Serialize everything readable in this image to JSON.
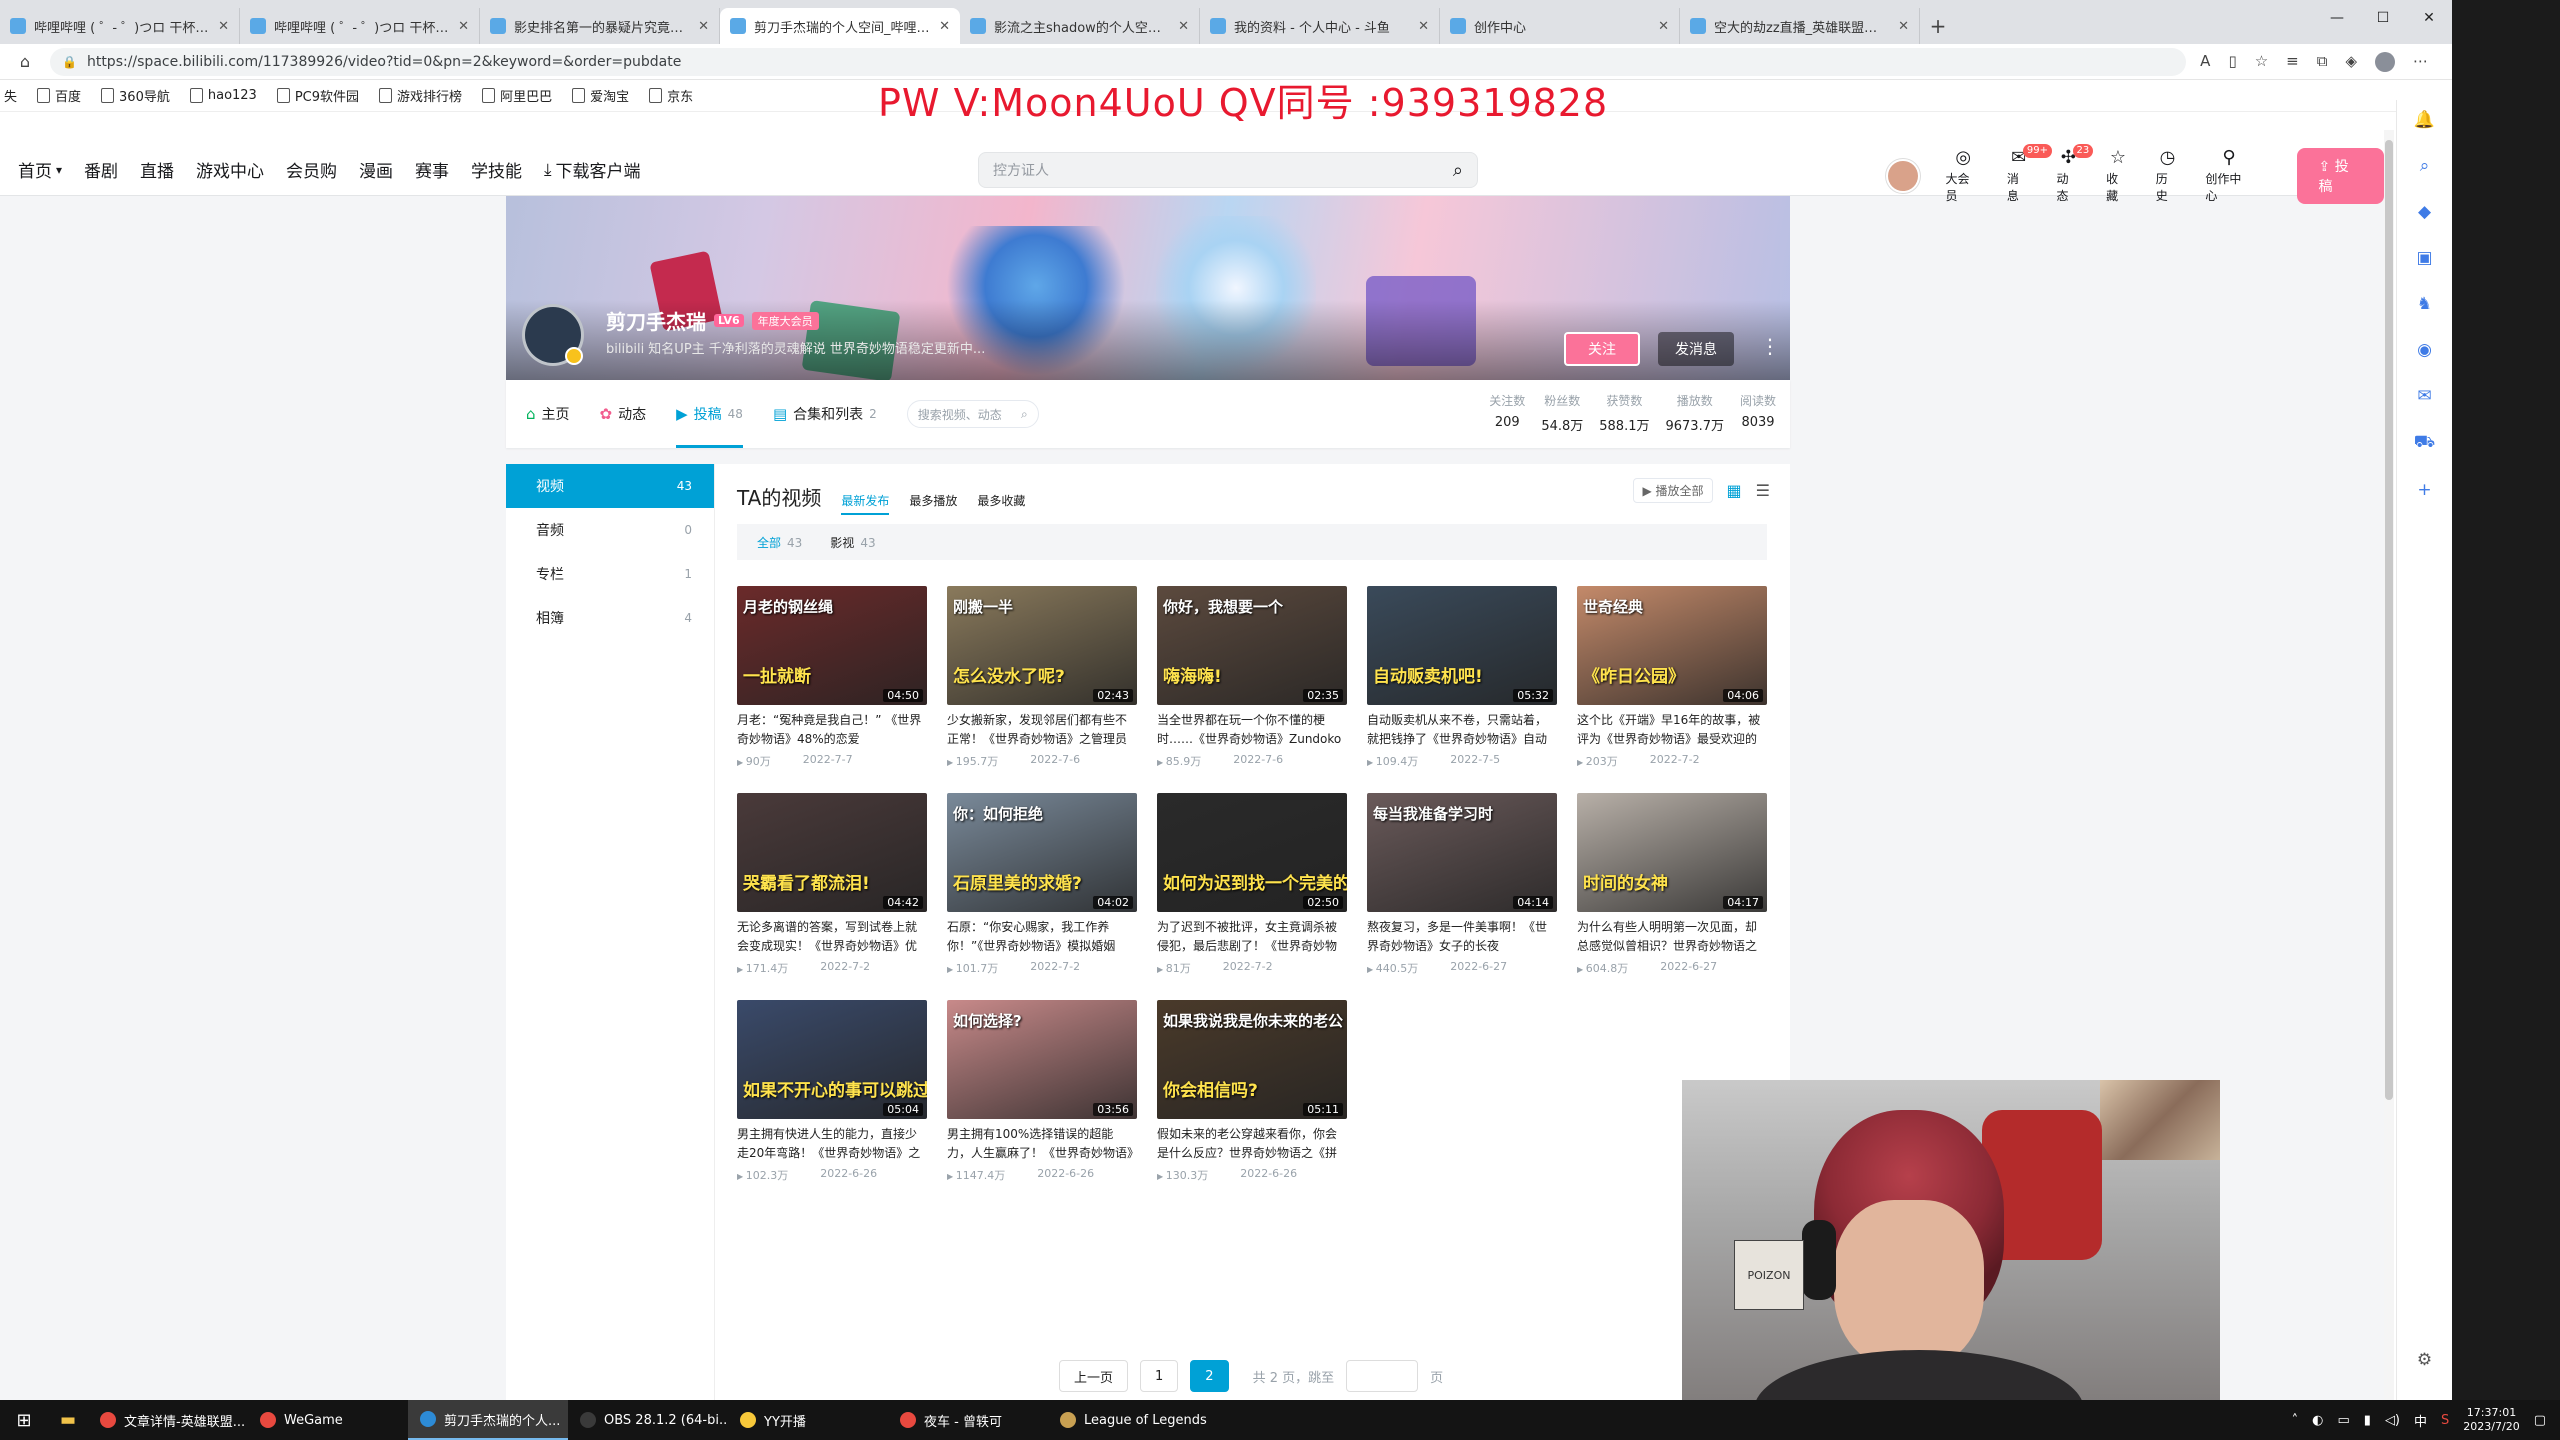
{
  "browser": {
    "tabs": [
      {
        "title": "哔哩哔哩 ( ゜- ゜)つロ 干杯~-bili",
        "active": false
      },
      {
        "title": "哔哩哔哩 ( ゜- ゜)つロ 干杯~-bili",
        "active": false
      },
      {
        "title": "影史排名第一的暴疑片究竟有多",
        "active": false
      },
      {
        "title": "剪刀手杰瑞的个人空间_哔哩哔哩",
        "active": true
      },
      {
        "title": "影流之主shadow的个人空间_哔",
        "active": false
      },
      {
        "title": "我的资料 - 个人中心 - 斗鱼",
        "active": false
      },
      {
        "title": "创作中心",
        "active": false
      },
      {
        "title": "空大的劫zz直播_英雄联盟直播_",
        "active": false
      }
    ],
    "url": "https://space.bilibili.com/117389926/video?tid=0&pn=2&keyword=&order=pubdate",
    "bookmarks": [
      "百度",
      "360导航",
      "hao123",
      "PC9软件园",
      "游戏排行榜",
      "阿里巴巴",
      "爱淘宝",
      "京东"
    ]
  },
  "watermark": "PW V:Moon4UoU QV同号 :939319828",
  "header": {
    "nav": [
      "首页",
      "番剧",
      "直播",
      "游戏中心",
      "会员购",
      "漫画",
      "赛事",
      "学技能",
      "下载客户端"
    ],
    "search_placeholder": "控方证人",
    "right": [
      {
        "label": "大会员",
        "icon": "vip-icon",
        "badge": ""
      },
      {
        "label": "消息",
        "icon": "message-icon",
        "badge": "99+"
      },
      {
        "label": "动态",
        "icon": "dynamic-icon",
        "badge": "23"
      },
      {
        "label": "收藏",
        "icon": "star-icon",
        "badge": ""
      },
      {
        "label": "历史",
        "icon": "history-icon",
        "badge": ""
      },
      {
        "label": "创作中心",
        "icon": "creator-icon",
        "badge": ""
      }
    ],
    "upload_label": "投稿"
  },
  "profile": {
    "name": "剪刀手杰瑞",
    "level": "LV6",
    "vip_tag": "年度大会员",
    "sign": "bilibili 知名UP主 千净利落的灵魂解说 世界奇妙物语稳定更新中...",
    "follow_label": "关注",
    "message_label": "发消息"
  },
  "space_nav": {
    "items": [
      {
        "label": "主页",
        "count": ""
      },
      {
        "label": "动态",
        "count": ""
      },
      {
        "label": "投稿",
        "count": "48"
      },
      {
        "label": "合集和列表",
        "count": "2"
      }
    ],
    "search_placeholder": "搜索视频、动态",
    "stats": [
      {
        "label": "关注数",
        "value": "209"
      },
      {
        "label": "粉丝数",
        "value": "54.8万"
      },
      {
        "label": "获赞数",
        "value": "588.1万"
      },
      {
        "label": "播放数",
        "value": "9673.7万"
      },
      {
        "label": "阅读数",
        "value": "8039"
      }
    ]
  },
  "left_menu": [
    {
      "label": "视频",
      "count": "43"
    },
    {
      "label": "音频",
      "count": "0"
    },
    {
      "label": "专栏",
      "count": "1"
    },
    {
      "label": "相簿",
      "count": "4"
    }
  ],
  "content": {
    "title": "TA的视频",
    "sorts": [
      "最新发布",
      "最多播放",
      "最多收藏"
    ],
    "play_all": "播放全部",
    "filters": [
      {
        "label": "全部",
        "count": "43"
      },
      {
        "label": "影视",
        "count": "43"
      }
    ],
    "videos": [
      {
        "title": "月老：“冤种竟是我自己！” 《世界奇妙物语》48%的恋爱",
        "plays": "90万",
        "date": "2022-7-7",
        "duration": "04:50",
        "cap": "月老的钢丝绳",
        "cap2": "一扯就断",
        "color": "#6b2a2a"
      },
      {
        "title": "少女搬新家，发现邻居们都有些不正常！《世界奇妙物语》之管理员",
        "plays": "195.7万",
        "date": "2022-7-6",
        "duration": "02:43",
        "cap": "刚搬一半",
        "cap2": "怎么没水了呢?",
        "color": "#8a7a5c"
      },
      {
        "title": "当全世界都在玩一个你不懂的梗时……《世界奇妙物语》Zundoko",
        "plays": "85.9万",
        "date": "2022-7-6",
        "duration": "02:35",
        "cap": "你好，我想要一个",
        "cap2": "嗨海嗨!",
        "color": "#5c4a3e"
      },
      {
        "title": "自动贩卖机从来不卷，只需站着，就把钱挣了《世界奇妙物语》自动",
        "plays": "109.4万",
        "date": "2022-7-5",
        "duration": "05:32",
        "cap": "",
        "cap2": "自动贩卖机吧!",
        "color": "#3a4a5a"
      },
      {
        "title": "这个比《开端》早16年的故事，被评为《世界奇妙物语》最受欢迎的",
        "plays": "203万",
        "date": "2022-7-2",
        "duration": "04:06",
        "cap": "世奇经典",
        "cap2": "《昨日公园》",
        "color": "#c48a6a"
      },
      {
        "title": "无论多离谱的答案，写到试卷上就会变成现实！《世界奇妙物语》优",
        "plays": "171.4万",
        "date": "2022-7-2",
        "duration": "04:42",
        "cap": "",
        "cap2": "哭霸看了都流泪!",
        "color": "#4a3a3a"
      },
      {
        "title": "石原：“你安心赐家，我工作养你！”《世界奇妙物语》模拟婚姻",
        "plays": "101.7万",
        "date": "2022-7-2",
        "duration": "04:02",
        "cap": "你：如何拒绝",
        "cap2": "石原里美的求婚?",
        "color": "#7a8a9a"
      },
      {
        "title": "为了迟到不被批评，女主竟调杀被侵犯，最后悲剧了！《世界奇妙物",
        "plays": "81万",
        "date": "2022-7-2",
        "duration": "02:50",
        "cap": "",
        "cap2": "如何为迟到找一个完美的借口?",
        "color": "#2a2a2a"
      },
      {
        "title": "熬夜复习，多是一件美事啊！《世界奇妙物语》女子的长夜",
        "plays": "440.5万",
        "date": "2022-6-27",
        "duration": "04:14",
        "cap": "每当我准备学习时",
        "cap2": "",
        "color": "#6a5a5a"
      },
      {
        "title": "为什么有些人明明第一次见面，却总感觉似曾相识？世界奇妙物语之",
        "plays": "604.8万",
        "date": "2022-6-27",
        "duration": "04:17",
        "cap": "",
        "cap2": "时间的女神",
        "color": "#b8b0a8"
      },
      {
        "title": "男主拥有快进人生的能力，直接少走20年弯路！《世界奇妙物语》之",
        "plays": "102.3万",
        "date": "2022-6-26",
        "duration": "05:04",
        "cap": "",
        "cap2": "如果不开心的事可以跳过",
        "color": "#3a4a6a"
      },
      {
        "title": "男主拥有100%选择错误的超能力，人生赢麻了！《世界奇妙物语》",
        "plays": "1147.4万",
        "date": "2022-6-26",
        "duration": "03:56",
        "cap": "如何选择?",
        "cap2": "",
        "color": "#c88a8a"
      },
      {
        "title": "假如未来的老公穿越来看你，你会是什么反应？世界奇妙物语之《拼",
        "plays": "130.3万",
        "date": "2022-6-26",
        "duration": "05:11",
        "cap": "如果我说我是你未来的老公",
        "cap2": "你会相信吗?",
        "color": "#4a3a2a"
      }
    ],
    "pager": {
      "prev": "上一页",
      "pages": [
        "1",
        "2"
      ],
      "current": "2",
      "info": "共 2 页，跳至",
      "unit": "页"
    }
  },
  "webcam": {
    "box_text": "POIZON"
  },
  "taskbar": {
    "apps": [
      {
        "label": "文章详情-英雄联盟...",
        "active": false
      },
      {
        "label": "WeGame",
        "active": false
      },
      {
        "label": "剪刀手杰瑞的个人...",
        "active": true
      },
      {
        "label": "OBS 28.1.2 (64-bi...",
        "active": false
      },
      {
        "label": "YY开播",
        "active": false
      },
      {
        "label": "夜车 - 曾轶可",
        "active": false
      },
      {
        "label": "League of Legends",
        "active": false
      }
    ],
    "ime": "中",
    "time": "17:37:01",
    "date": "2023/7/20"
  }
}
